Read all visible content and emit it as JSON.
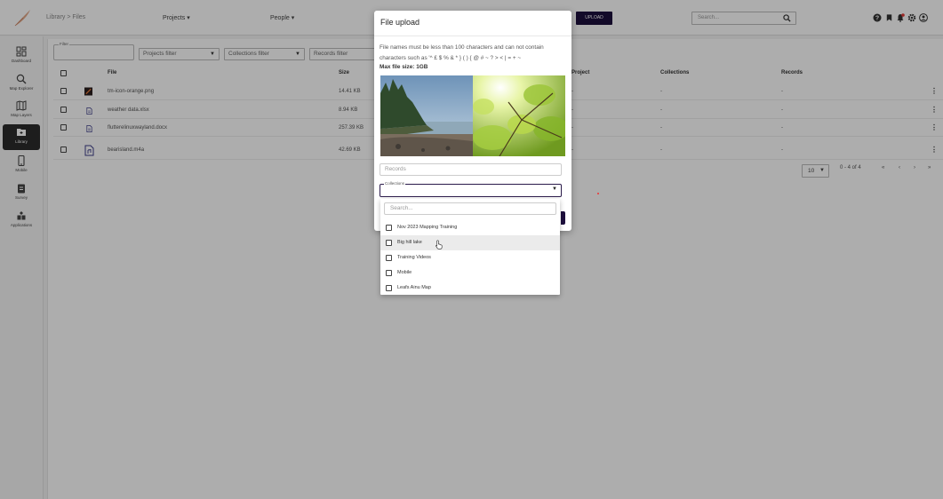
{
  "topbar": {
    "breadcrumb": "Library > Files",
    "nav_projects": "Projects ▾",
    "nav_people": "People ▾",
    "upload_label": "UPLOAD",
    "search_placeholder": "Search..."
  },
  "sidebar": {
    "items": [
      {
        "label": "Dashboard"
      },
      {
        "label": "Map Explorer"
      },
      {
        "label": "Map Layers"
      },
      {
        "label": "Library"
      },
      {
        "label": "Mobile"
      },
      {
        "label": "Survey"
      },
      {
        "label": "Applications"
      }
    ]
  },
  "filters": {
    "filter_legend": "Filter",
    "projects_filter": "Projects filter",
    "collections_filter": "Collections filter",
    "records_filter": "Records filter"
  },
  "table": {
    "headers": {
      "file": "File",
      "size": "Size",
      "project": "Project",
      "collections": "Collections",
      "records": "Records"
    },
    "rows": [
      {
        "file": "tm-icon-orange.png",
        "size": "14.41 KB",
        "project": "-",
        "collections": "-",
        "records": "-"
      },
      {
        "file": "weather data.xlsx",
        "size": "8.94 KB",
        "project": "-",
        "collections": "-",
        "records": "-"
      },
      {
        "file": "flutterelinuxwayland.docx",
        "size": "257.39 KB",
        "project": "-",
        "collections": "-",
        "records": "-"
      },
      {
        "file": "bearisland.m4a",
        "size": "42.69 KB",
        "project": "-",
        "collections": "-",
        "records": "-"
      }
    ]
  },
  "pagination": {
    "rows_per_page": "10",
    "range": "0 - 4 of 4",
    "first": "«",
    "prev": "‹",
    "next": "›",
    "last": "»"
  },
  "modal": {
    "title": "File upload",
    "description": "File names must be less than 100 characters and can not contain characters such as '^ £ $ % & * } ( ) { @ # ~ ? > < | = + ~",
    "max_size": "Max file size: 1GB",
    "records_placeholder": "Records",
    "collections_label": "Collections"
  },
  "dropdown": {
    "search_placeholder": "Search...",
    "options": [
      {
        "label": "Nov 2023 Mapping Training"
      },
      {
        "label": "Big hill lake"
      },
      {
        "label": "Training Videos"
      },
      {
        "label": "Mobile"
      },
      {
        "label": "Leafs Ainu Map"
      }
    ]
  },
  "colors": {
    "accent": "#1d0f3d",
    "sidebar_active": "#2c2c2c",
    "notification": "#e53935"
  }
}
